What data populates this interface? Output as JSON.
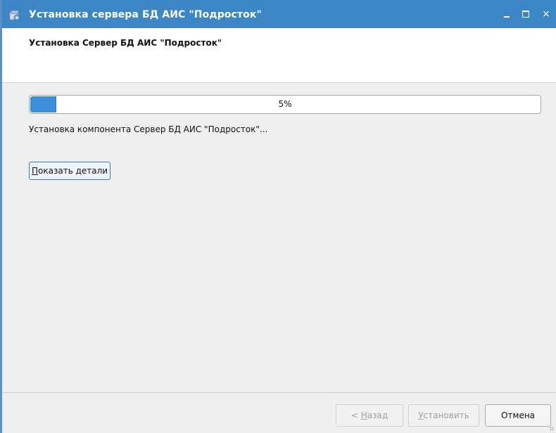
{
  "window": {
    "title": "Установка сервера БД АИС \"Подросток\"",
    "icon": "installer-icon",
    "controls": {
      "minimize": "minimize-icon",
      "maximize": "maximize-icon",
      "close": "×"
    }
  },
  "header": {
    "heading": "Установка Сервер БД АИС \"Подросток\""
  },
  "progress": {
    "value": 5,
    "label": "5%"
  },
  "status_text": "Установка компонента Сервер БД АИС \"Подросток\"...",
  "details_button": "Показать детали",
  "footer": {
    "back_label": "< Назад",
    "install_label": "Установить",
    "cancel_label": "Отмена"
  },
  "colors": {
    "titlebar": "#3d86c6",
    "progress_fill": "#3b8fdb"
  }
}
